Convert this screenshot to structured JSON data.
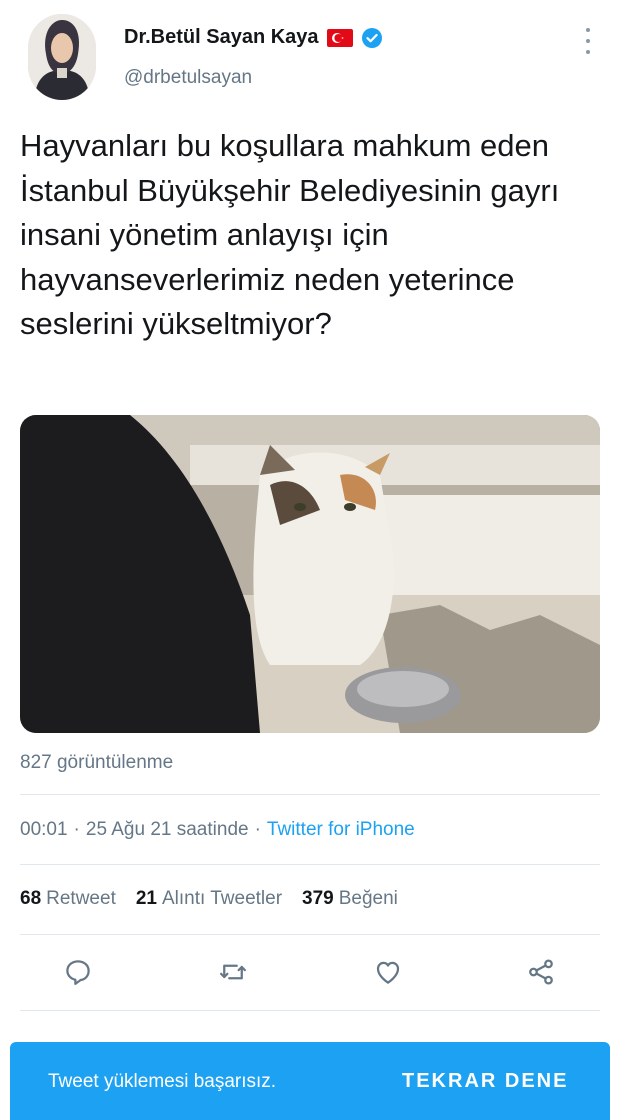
{
  "author": {
    "name": "Dr.Betül Sayan Kaya",
    "handle": "@drbetulsayan",
    "verified": true,
    "flag_icon": "turkey-flag-icon"
  },
  "tweet": {
    "text": "Hayvanları bu koşullara mahkum eden İstanbul Büyükşehir Belediyesinin gayrı insani yönetim anlayışı için hayvanseverlerimiz neden yeterince seslerini yükseltmiyor?",
    "views": "827 görüntülenme",
    "time": "00:01",
    "date": "25 Ağu 21 saatinde",
    "separator": "·",
    "source": "Twitter for iPhone"
  },
  "stats": [
    {
      "count": "68",
      "label": "Retweet"
    },
    {
      "count": "21",
      "label": "Alıntı Tweetler"
    },
    {
      "count": "379",
      "label": "Beğeni"
    }
  ],
  "actions": [
    "reply-icon",
    "retweet-icon",
    "like-icon",
    "share-icon"
  ],
  "toast": {
    "message": "Tweet yüklemesi başarısız.",
    "retry_label": "TEKRAR DENE"
  },
  "colors": {
    "accent": "#1da1f2",
    "secondary_text": "#657786",
    "primary_text": "#14171a",
    "divider": "#e1e8ed"
  }
}
